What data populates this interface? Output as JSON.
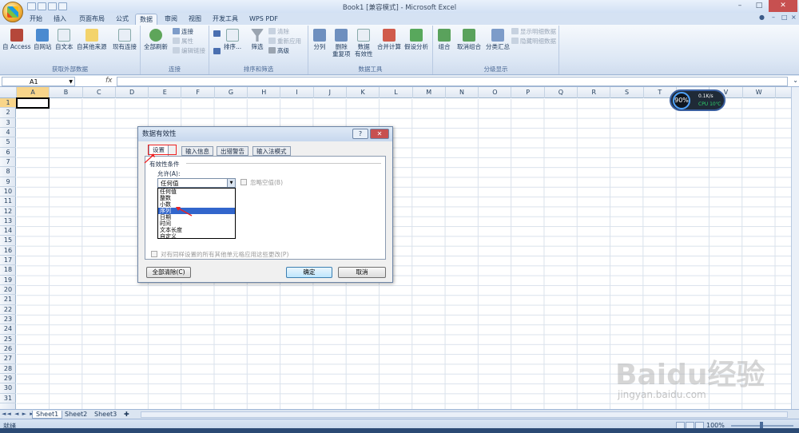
{
  "window": {
    "title": "Book1 [兼容模式] - Microsoft Excel",
    "minimize": "–",
    "maximize": "□",
    "close": "✕"
  },
  "tabs": [
    "开始",
    "插入",
    "页面布局",
    "公式",
    "数据",
    "审阅",
    "视图",
    "开发工具",
    "WPS PDF"
  ],
  "active_tab": "数据",
  "ribbon": {
    "groups": [
      "获取外部数据",
      "连接",
      "排序和筛选",
      "数据工具",
      "分级显示"
    ],
    "external": [
      "自 Access",
      "自网站",
      "自文本",
      "自其他来源",
      "现有连接"
    ],
    "connections": {
      "refresh": "全部刷新",
      "conn": "连接",
      "props": "属性",
      "edit_links": "编辑链接"
    },
    "sort": {
      "sort": "排序...",
      "filter": "筛选",
      "clear": "清除",
      "reapply": "重新应用",
      "advanced": "高级"
    },
    "tools": [
      "分列",
      "删除\n重复项",
      "数据\n有效性",
      "合并计算",
      "假设分析"
    ],
    "outline": {
      "group": "组合",
      "ungroup": "取消组合",
      "subtotal": "分类汇总",
      "show": "显示明细数据",
      "hide": "隐藏明细数据"
    }
  },
  "formula_bar": {
    "name_box": "A1",
    "fx": "fx"
  },
  "columns": [
    "A",
    "B",
    "C",
    "D",
    "E",
    "F",
    "G",
    "H",
    "I",
    "J",
    "K",
    "L",
    "M",
    "N",
    "O",
    "P",
    "Q",
    "R",
    "S",
    "T",
    "U",
    "V",
    "W"
  ],
  "rows": [
    "1",
    "2",
    "3",
    "4",
    "5",
    "6",
    "7",
    "8",
    "9",
    "10",
    "11",
    "12",
    "13",
    "14",
    "15",
    "16",
    "17",
    "18",
    "19",
    "20",
    "21",
    "22",
    "23",
    "24",
    "25",
    "26",
    "27",
    "28",
    "29",
    "30",
    "31"
  ],
  "sheets": [
    "Sheet1",
    "Sheet2",
    "Sheet3"
  ],
  "status": {
    "ready": "就绪",
    "zoom": "100%"
  },
  "dialog": {
    "title": "数据有效性",
    "help": "?",
    "close": "✕",
    "tabs": [
      "设置",
      "输入信息",
      "出错警告",
      "输入法模式"
    ],
    "section": "有效性条件",
    "allow_label": "允许(A):",
    "allow_value": "任何值",
    "ignore_blank": "忽略空值(B)",
    "options": [
      "任何值",
      "整数",
      "小数",
      "序列",
      "日期",
      "时间",
      "文本长度",
      "自定义"
    ],
    "selected_option": "序列",
    "apply_all": "对有同样设置的所有其他单元格应用这些更改(P)",
    "clear_all": "全部清除(C)",
    "ok": "确定",
    "cancel": "取消"
  },
  "widget": {
    "percent": "90%",
    "speed": "0.1K/s",
    "cpu": "CPU 10℃"
  },
  "watermark": {
    "logo": "Baidu经验",
    "url": "jingyan.baidu.com"
  }
}
